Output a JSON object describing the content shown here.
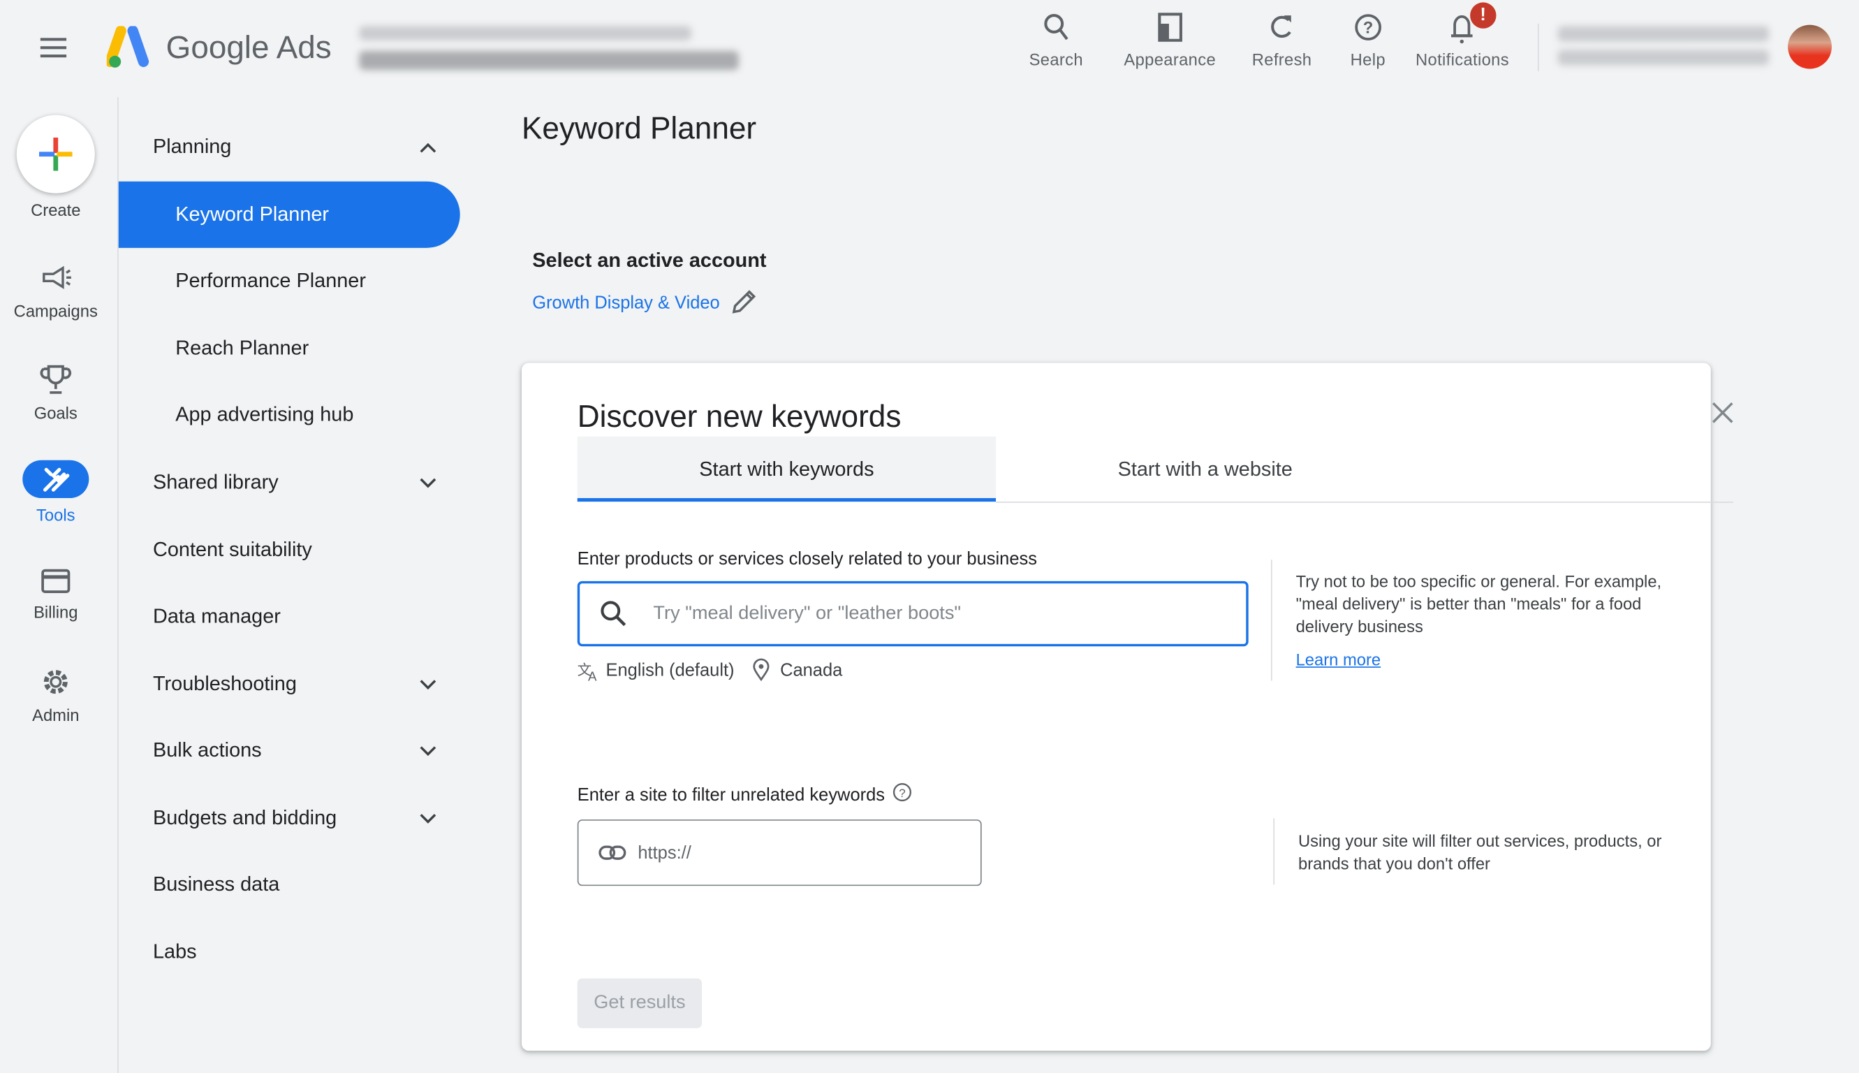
{
  "header": {
    "app_name": "Google Ads",
    "actions": [
      {
        "label": "Search",
        "icon": "search-icon"
      },
      {
        "label": "Appearance",
        "icon": "appearance-icon"
      },
      {
        "label": "Refresh",
        "icon": "refresh-icon"
      },
      {
        "label": "Help",
        "icon": "help-icon"
      },
      {
        "label": "Notifications",
        "icon": "bell-icon",
        "badge": "!"
      }
    ]
  },
  "rail": [
    {
      "label": "Create",
      "icon": "plus-icon"
    },
    {
      "label": "Campaigns",
      "icon": "megaphone-icon"
    },
    {
      "label": "Goals",
      "icon": "trophy-icon"
    },
    {
      "label": "Tools",
      "icon": "tools-icon",
      "active": true
    },
    {
      "label": "Billing",
      "icon": "credit-card-icon"
    },
    {
      "label": "Admin",
      "icon": "gear-icon"
    }
  ],
  "sidebar": {
    "items": [
      {
        "label": "Planning",
        "expanded": true
      },
      {
        "label": "Keyword Planner",
        "active": true
      },
      {
        "label": "Performance Planner"
      },
      {
        "label": "Reach Planner"
      },
      {
        "label": "App advertising hub"
      },
      {
        "label": "Shared library"
      },
      {
        "label": "Content suitability"
      },
      {
        "label": "Data manager"
      },
      {
        "label": "Troubleshooting"
      },
      {
        "label": "Bulk actions"
      },
      {
        "label": "Budgets and bidding"
      },
      {
        "label": "Business data"
      },
      {
        "label": "Labs"
      }
    ]
  },
  "main": {
    "page_title": "Keyword Planner",
    "account_heading": "Select an active account",
    "account_name": "Growth Display & Video",
    "card": {
      "title": "Discover new keywords",
      "tabs": [
        {
          "label": "Start with keywords",
          "active": true
        },
        {
          "label": "Start with a website"
        }
      ],
      "keywords_label": "Enter products or services closely related to your business",
      "keywords_placeholder": "Try \"meal delivery\" or \"leather boots\"",
      "language": "English (default)",
      "location": "Canada",
      "tip": "Try not to be too specific or general. For example, \"meal delivery\" is better than \"meals\" for a food delivery business",
      "learn_more": "Learn more",
      "site_label": "Enter a site to filter unrelated keywords",
      "site_placeholder": "https://",
      "site_tip": "Using your site will filter out services, products, or brands that you don't offer",
      "get_results": "Get results"
    }
  },
  "colors": {
    "accent": "#1a73e8",
    "badge": "#c5392b",
    "background": "#f1f3f4"
  }
}
